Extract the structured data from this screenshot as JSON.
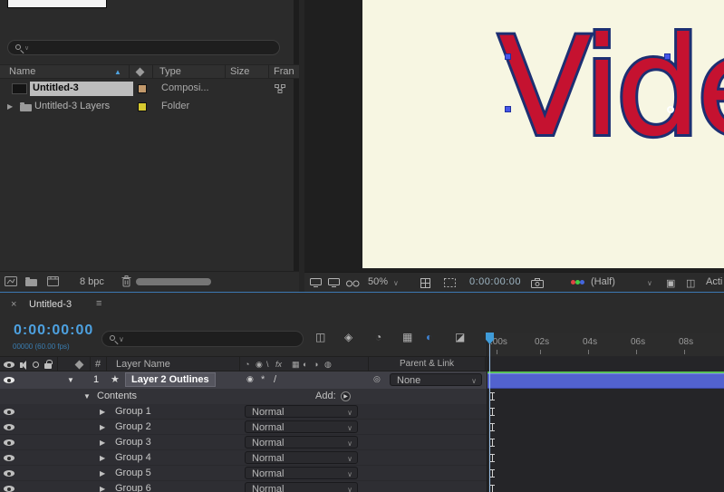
{
  "project": {
    "columns": {
      "name": "Name",
      "type": "Type",
      "size": "Size",
      "frame": "Fran"
    },
    "rows": [
      {
        "name": "Untitled-3",
        "type": "Composi..."
      },
      {
        "name": "Untitled-3 Layers",
        "type": "Folder"
      }
    ],
    "footer": {
      "depth": "8 bpc"
    }
  },
  "viewer": {
    "text": "Vide",
    "zoom": "50%",
    "timecode": "0:00:00:00",
    "resolution": "(Half)",
    "camera_label": "Acti"
  },
  "timeline": {
    "tab_title": "Untitled-3",
    "timecode": "0:00:00:00",
    "frame_info": "00000 (60.00 fps)",
    "ruler": [
      ":00s",
      "02s",
      "04s",
      "06s",
      "08s"
    ],
    "columns": {
      "hash": "#",
      "layer_name": "Layer Name",
      "parent": "Parent & Link"
    },
    "layer": {
      "index": "1",
      "name": "Layer 2 Outlines",
      "parent_value": "None"
    },
    "contents": {
      "label": "Contents",
      "add_label": "Add:"
    },
    "groups": [
      {
        "label": "Group 1",
        "mode": "Normal"
      },
      {
        "label": "Group 2",
        "mode": "Normal"
      },
      {
        "label": "Group 3",
        "mode": "Normal"
      },
      {
        "label": "Group 4",
        "mode": "Normal"
      },
      {
        "label": "Group 5",
        "mode": "Normal"
      },
      {
        "label": "Group 6",
        "mode": "Normal"
      }
    ]
  },
  "icons": {
    "close": "×",
    "menu": "≡",
    "sort_asc": "▲",
    "expand_right": "▶",
    "expand_down": "▼",
    "star": "★",
    "chevron_down": "∨",
    "pick_whip": "◎",
    "add_play": "▶",
    "toolbar_glyphs": [
      "◫",
      "◈",
      "◔",
      "▦",
      "◐",
      "◪"
    ],
    "switch_glyphs": [
      "◔",
      "◉",
      "\\",
      "fx",
      "▦",
      "◐",
      "◑",
      "◍"
    ],
    "layer_switch_glyphs": [
      "◉",
      "*",
      "/"
    ],
    "comp_toolbar_glyphs": [
      "▣",
      "◫"
    ]
  },
  "colors": {
    "accent": "#3f9bd8",
    "layer_bar": "#5262cf",
    "cache_green": "#58c158",
    "comp_bg": "#f7f6e2",
    "title_fill": "#c51230",
    "title_stroke": "#1d2f72"
  }
}
